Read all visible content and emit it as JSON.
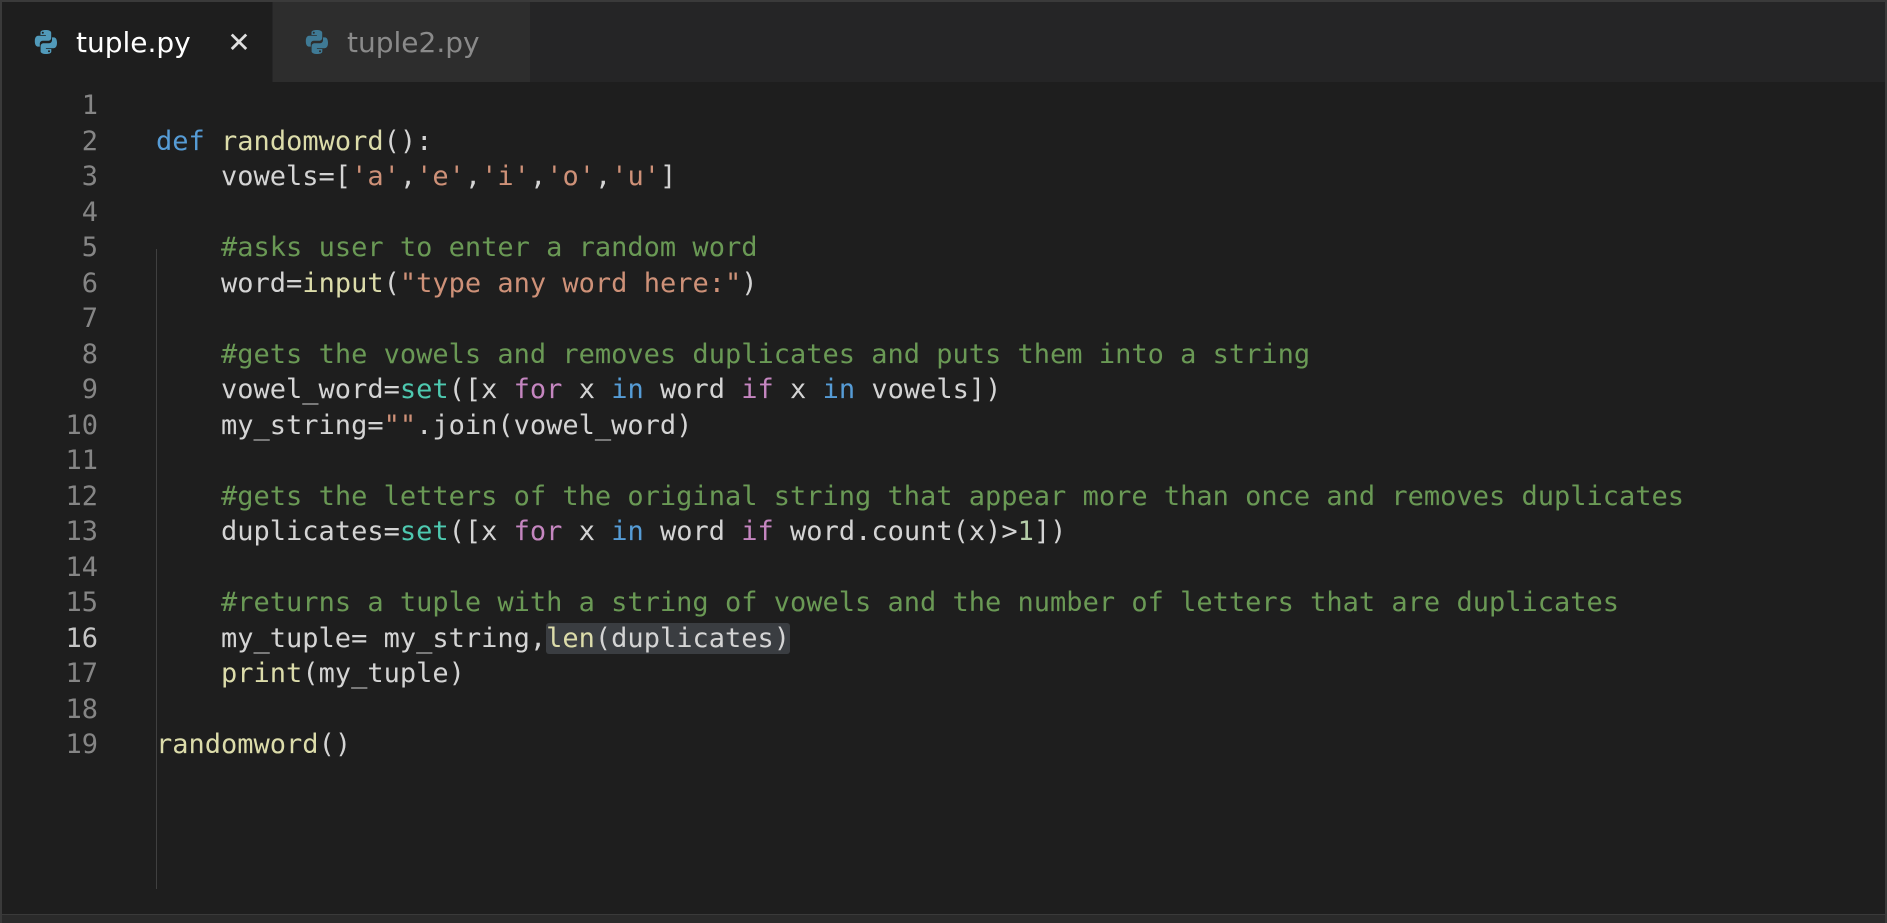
{
  "tabs": [
    {
      "label": "tuple.py",
      "active": true,
      "icon": "python-icon",
      "close": "✕"
    },
    {
      "label": "tuple2.py",
      "active": false,
      "icon": "python-icon"
    }
  ],
  "editor": {
    "current_line": 16,
    "lines": [
      {
        "n": "1",
        "text": ""
      },
      {
        "n": "2",
        "text": "def randomword():"
      },
      {
        "n": "3",
        "text": "    vowels=['a','e','i','o','u']"
      },
      {
        "n": "4",
        "text": ""
      },
      {
        "n": "5",
        "text": "    #asks user to enter a random word"
      },
      {
        "n": "6",
        "text": "    word=input(\"type any word here:\")"
      },
      {
        "n": "7",
        "text": ""
      },
      {
        "n": "8",
        "text": "    #gets the vowels and removes duplicates and puts them into a string"
      },
      {
        "n": "9",
        "text": "    vowel_word=set([x for x in word if x in vowels])"
      },
      {
        "n": "10",
        "text": "    my_string=\"\".join(vowel_word)"
      },
      {
        "n": "11",
        "text": ""
      },
      {
        "n": "12",
        "text": "    #gets the letters of the original string that appear more than once and removes duplicates"
      },
      {
        "n": "13",
        "text": "    duplicates=set([x for x in word if word.count(x)>1])"
      },
      {
        "n": "14",
        "text": ""
      },
      {
        "n": "15",
        "text": "    #returns a tuple with a string of vowels and the number of letters that are duplicates"
      },
      {
        "n": "16",
        "text": "    my_tuple= my_string,len(duplicates)"
      },
      {
        "n": "17",
        "text": "    print(my_tuple)"
      },
      {
        "n": "18",
        "text": ""
      },
      {
        "n": "19",
        "text": "randomword()"
      }
    ]
  },
  "colors": {
    "background": "#1e1e1e",
    "keyword": "#569cd6",
    "function": "#dcdcaa",
    "string": "#ce9178",
    "comment": "#6a9955",
    "builtin": "#4ec9b0",
    "control": "#c586c0",
    "number": "#b5cea8"
  }
}
